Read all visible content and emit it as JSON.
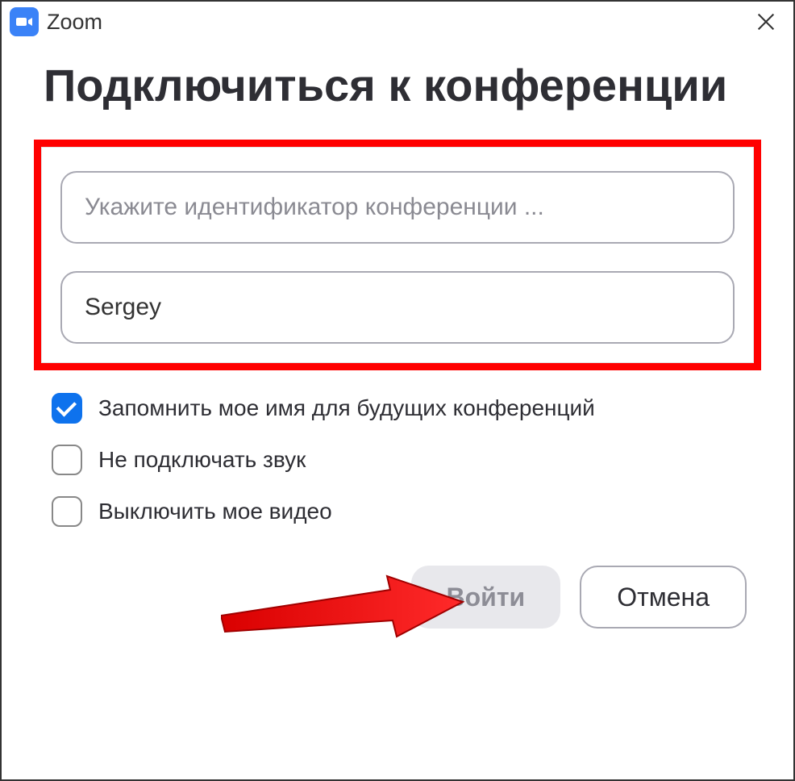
{
  "titlebar": {
    "app_name": "Zoom"
  },
  "heading": "Подключиться к конференции",
  "inputs": {
    "meeting_id": {
      "placeholder": "Укажите идентификатор конференции ...",
      "value": ""
    },
    "name": {
      "value": "Sergey",
      "placeholder": ""
    }
  },
  "options": {
    "remember_name": {
      "label": "Запомнить мое имя для будущих конференций",
      "checked": true
    },
    "no_audio": {
      "label": "Не подключать звук",
      "checked": false
    },
    "no_video": {
      "label": "Выключить мое видео",
      "checked": false
    }
  },
  "buttons": {
    "submit": "Войти",
    "cancel": "Отмена"
  }
}
